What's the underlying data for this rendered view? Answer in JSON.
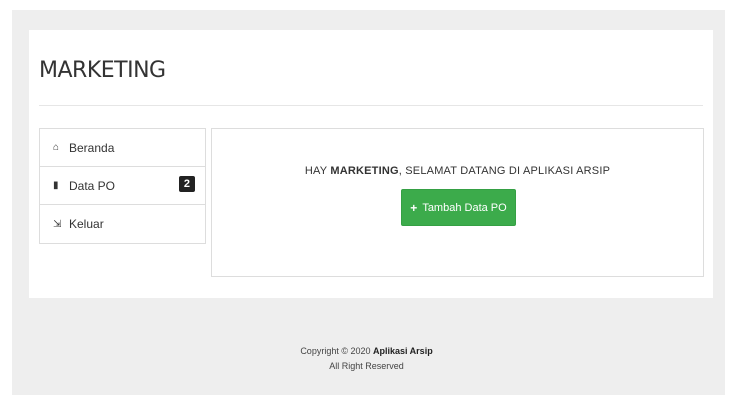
{
  "header": {
    "title": "MARKETING"
  },
  "sidebar": {
    "items": [
      {
        "label": "Beranda",
        "icon": "home-icon",
        "glyph": "⌂"
      },
      {
        "label": "Data PO",
        "icon": "file-icon",
        "glyph": "▮",
        "badge": "2"
      },
      {
        "label": "Keluar",
        "icon": "logout-icon",
        "glyph": "⇲"
      }
    ]
  },
  "main": {
    "greeting_prefix": "HAY ",
    "greeting_user": "MARKETING",
    "greeting_suffix": ", SELAMAT DATANG DI APLIKASI ARSIP",
    "add_button": {
      "icon": "plus-icon",
      "glyph": "+",
      "label": "Tambah Data PO"
    }
  },
  "footer": {
    "copyright_prefix": "Copyright © 2020 ",
    "app_name": "Aplikasi Arsip",
    "rights": "All Right Reserved"
  },
  "colors": {
    "background": "#eeeeee",
    "card": "#ffffff",
    "accent_green": "#3cab4b",
    "badge_bg": "#222222"
  }
}
